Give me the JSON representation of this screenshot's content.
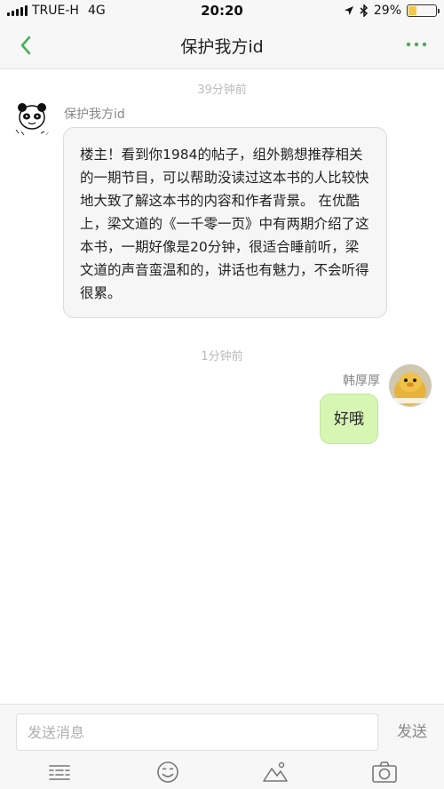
{
  "status_bar": {
    "carrier": "TRUE-H",
    "network": "4G",
    "time": "20:20",
    "battery": "29%",
    "battery_level": 0.29
  },
  "nav": {
    "title": "保护我方id",
    "back_icon": "chevron-left-icon",
    "more_icon": "more-dots-icon"
  },
  "messages": [
    {
      "timestamp": "39分钟前",
      "sender": "保护我方id",
      "side": "left",
      "text": "楼主！看到你1984的帖子，组外鹅想推荐相关的一期节目，可以帮助没读过这本书的人比较快地大致了解这本书的内容和作者背景。 在优酷上，梁文道的《一千零一页》中有两期介绍了这本书，一期好像是20分钟，很适合睡前听，梁文道的声音蛮温和的，讲话也有魅力，不会听得很累。"
    },
    {
      "timestamp": "1分钟前",
      "sender": "韩厚厚",
      "side": "right",
      "text": "好哦"
    }
  ],
  "input": {
    "placeholder": "发送消息",
    "value": "",
    "send_label": "发送"
  },
  "toolbar": [
    "text-lines-icon",
    "emoji-smile-icon",
    "image-mountain-icon",
    "camera-icon"
  ],
  "colors": {
    "accent_green": "#3fb24f",
    "right_bubble": "#d8f6b3",
    "left_bubble": "#f6f6f6",
    "battery": "#f2c94c"
  }
}
